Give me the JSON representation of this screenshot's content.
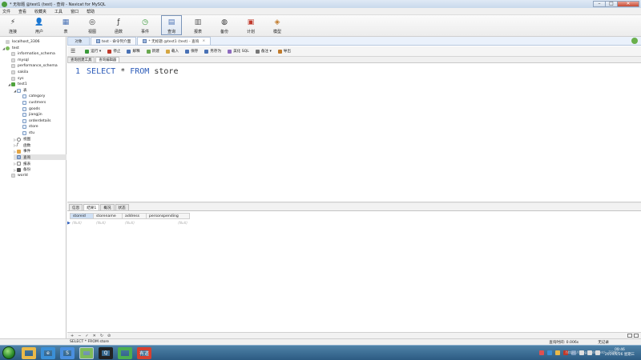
{
  "window": {
    "title": "* 无标题 @test1 (test) - 查询 - Navicat for MySQL",
    "minimize": "–",
    "maximize": "□",
    "close": "✕"
  },
  "menu": [
    "文件",
    "查看",
    "收藏夹",
    "工具",
    "窗口",
    "帮助"
  ],
  "toolbar": [
    {
      "label": "连接",
      "icon": "connection-icon",
      "glyph": "⚡",
      "color": "#333333"
    },
    {
      "label": "用户",
      "icon": "user-icon",
      "glyph": "👤",
      "color": "#d08a2a"
    },
    {
      "label": "表",
      "icon": "table-icon",
      "glyph": "▦",
      "color": "#4a72b5"
    },
    {
      "label": "视图",
      "icon": "view-icon",
      "glyph": "◎",
      "color": "#333333"
    },
    {
      "label": "函数",
      "icon": "function-icon",
      "glyph": "ƒ",
      "color": "#333333"
    },
    {
      "label": "事件",
      "icon": "event-icon",
      "glyph": "◷",
      "color": "#3a9a3a"
    },
    {
      "label": "查询",
      "icon": "query-icon",
      "glyph": "▤",
      "color": "#4a72b5",
      "active": true
    },
    {
      "label": "报表",
      "icon": "report-icon",
      "glyph": "▥",
      "color": "#555555"
    },
    {
      "label": "备份",
      "icon": "backup-icon",
      "glyph": "◍",
      "color": "#333333"
    },
    {
      "label": "计划",
      "icon": "schedule-icon",
      "glyph": "▣",
      "color": "#c0392b"
    },
    {
      "label": "模型",
      "icon": "model-icon",
      "glyph": "◈",
      "color": "#c17a2a"
    }
  ],
  "tree": [
    {
      "label": "localhost_3306",
      "indent": 0,
      "toggle": "",
      "icon": "conn-off",
      "name": "connection-localhost"
    },
    {
      "label": "test",
      "indent": 0,
      "toggle": "◢",
      "icon": "conn",
      "name": "connection-test"
    },
    {
      "label": "information_schema",
      "indent": 1,
      "toggle": "",
      "icon": "db-off",
      "name": "db-information-schema"
    },
    {
      "label": "mysql",
      "indent": 1,
      "toggle": "",
      "icon": "db-off",
      "name": "db-mysql"
    },
    {
      "label": "performance_schema",
      "indent": 1,
      "toggle": "",
      "icon": "db-off",
      "name": "db-performance-schema"
    },
    {
      "label": "sakila",
      "indent": 1,
      "toggle": "",
      "icon": "db-off",
      "name": "db-sakila"
    },
    {
      "label": "sys",
      "indent": 1,
      "toggle": "",
      "icon": "db-off",
      "name": "db-sys"
    },
    {
      "label": "test1",
      "indent": 1,
      "toggle": "◢",
      "icon": "db-on",
      "name": "db-test1"
    },
    {
      "label": "表",
      "indent": 2,
      "toggle": "◢",
      "icon": "tbl",
      "name": "node-tables"
    },
    {
      "label": "category",
      "indent": 3,
      "toggle": "",
      "icon": "tbl",
      "name": "table-category"
    },
    {
      "label": "custmers",
      "indent": 3,
      "toggle": "",
      "icon": "tbl",
      "name": "table-custmers"
    },
    {
      "label": "goods",
      "indent": 3,
      "toggle": "",
      "icon": "tbl",
      "name": "table-goods"
    },
    {
      "label": "jiangjin",
      "indent": 3,
      "toggle": "",
      "icon": "tbl",
      "name": "table-jiangjin"
    },
    {
      "label": "orderdetails",
      "indent": 3,
      "toggle": "",
      "icon": "tbl",
      "name": "table-orderdetails"
    },
    {
      "label": "store",
      "indent": 3,
      "toggle": "",
      "icon": "tbl",
      "name": "table-store"
    },
    {
      "label": "stu",
      "indent": 3,
      "toggle": "",
      "icon": "tbl",
      "name": "table-stu"
    },
    {
      "label": "视图",
      "indent": 2,
      "toggle": "▷",
      "icon": "view",
      "name": "node-views"
    },
    {
      "label": "函数",
      "indent": 2,
      "toggle": "▷",
      "icon": "func",
      "name": "node-functions"
    },
    {
      "label": "事件",
      "indent": 2,
      "toggle": "▷",
      "icon": "event",
      "name": "node-events"
    },
    {
      "label": "查询",
      "indent": 2,
      "toggle": "",
      "icon": "query",
      "name": "node-queries",
      "selected": true
    },
    {
      "label": "报表",
      "indent": 2,
      "toggle": "▷",
      "icon": "report",
      "name": "node-reports"
    },
    {
      "label": "备份",
      "indent": 2,
      "toggle": "▷",
      "icon": "backup",
      "name": "node-backups"
    },
    {
      "label": "world",
      "indent": 1,
      "toggle": "",
      "icon": "db-off",
      "name": "db-world"
    }
  ],
  "tabs": {
    "object": "对象",
    "items": [
      {
        "label": "test - 命令列介面",
        "active": false
      },
      {
        "label": "* 无标题 @test1 (test) - 查询",
        "active": true
      }
    ],
    "close_glyph": "×"
  },
  "querybar": {
    "menu_glyph": "☰",
    "buttons": [
      {
        "label": "运行 ▾",
        "color": "#3a9a3a",
        "name": "run-button"
      },
      {
        "label": "停止",
        "color": "#c0392b",
        "name": "stop-button"
      },
      {
        "label": "解释",
        "color": "#4a72b5",
        "name": "explain-button"
      },
      {
        "label": "新建",
        "color": "#6aa84f",
        "name": "new-button"
      },
      {
        "label": "载入",
        "color": "#d5a642",
        "name": "load-button"
      },
      {
        "label": "保存",
        "color": "#4a72b5",
        "name": "save-button"
      },
      {
        "label": "另存为",
        "color": "#4a72b5",
        "name": "save-as-button"
      },
      {
        "label": "美化 SQL",
        "color": "#8e6bbf",
        "name": "beautify-sql-button"
      },
      {
        "label": "备注 ▾",
        "color": "#777777",
        "name": "comment-button"
      },
      {
        "label": "导出",
        "color": "#c17a2a",
        "name": "export-button"
      }
    ]
  },
  "subtabs": [
    {
      "label": "查询创建工具",
      "active": false
    },
    {
      "label": "查询编辑器",
      "active": true
    }
  ],
  "editor": {
    "line_number": "1",
    "kw1": "SELECT",
    "star": "*",
    "kw2": "FROM",
    "table": "store"
  },
  "result_tabs": [
    {
      "label": "信息",
      "active": false
    },
    {
      "label": "结果1",
      "active": true
    },
    {
      "label": "概况",
      "active": false
    },
    {
      "label": "状态",
      "active": false
    }
  ],
  "grid": {
    "columns": [
      "storeid",
      "storename",
      "address",
      "personspending"
    ],
    "row": [
      "(Null)",
      "(Null)",
      "(Null)",
      "(Null)"
    ],
    "row_marker": "▶"
  },
  "nav_buttons": [
    "+",
    "−",
    "✓",
    "✕",
    "↻",
    "⊘"
  ],
  "status": {
    "sql": "SELECT * FROM store",
    "time": "查询时间: 0.006s",
    "records": "无记录"
  },
  "taskbar": {
    "apps": [
      {
        "name": "taskbar-explorer",
        "color": "#e9b949",
        "glyph": "",
        "active": false
      },
      {
        "name": "taskbar-ie",
        "color": "#3b8fd6",
        "glyph": "e",
        "active": false
      },
      {
        "name": "taskbar-sogou",
        "color": "#4a8fe0",
        "glyph": "S",
        "active": false
      },
      {
        "name": "taskbar-navicat",
        "color": "#7dbb5a",
        "glyph": "",
        "active": true
      },
      {
        "name": "taskbar-qq",
        "color": "#222222",
        "glyph": "Q",
        "active": false
      },
      {
        "name": "taskbar-wechat",
        "color": "#4caf50",
        "glyph": "",
        "active": false
      },
      {
        "name": "taskbar-youdao",
        "color": "#d64030",
        "glyph": "有道",
        "active": false
      }
    ],
    "tray_colors": [
      "#e05050",
      "#3b8fd6",
      "#e9b949",
      "#c0392b",
      "#7b9cc0",
      "#dddddd",
      "#dddddd",
      "#dddddd"
    ],
    "time": "09:46",
    "date": "2019/6/26 星期三"
  },
  "watermark": "https://blog.csdn.net/...TONG"
}
